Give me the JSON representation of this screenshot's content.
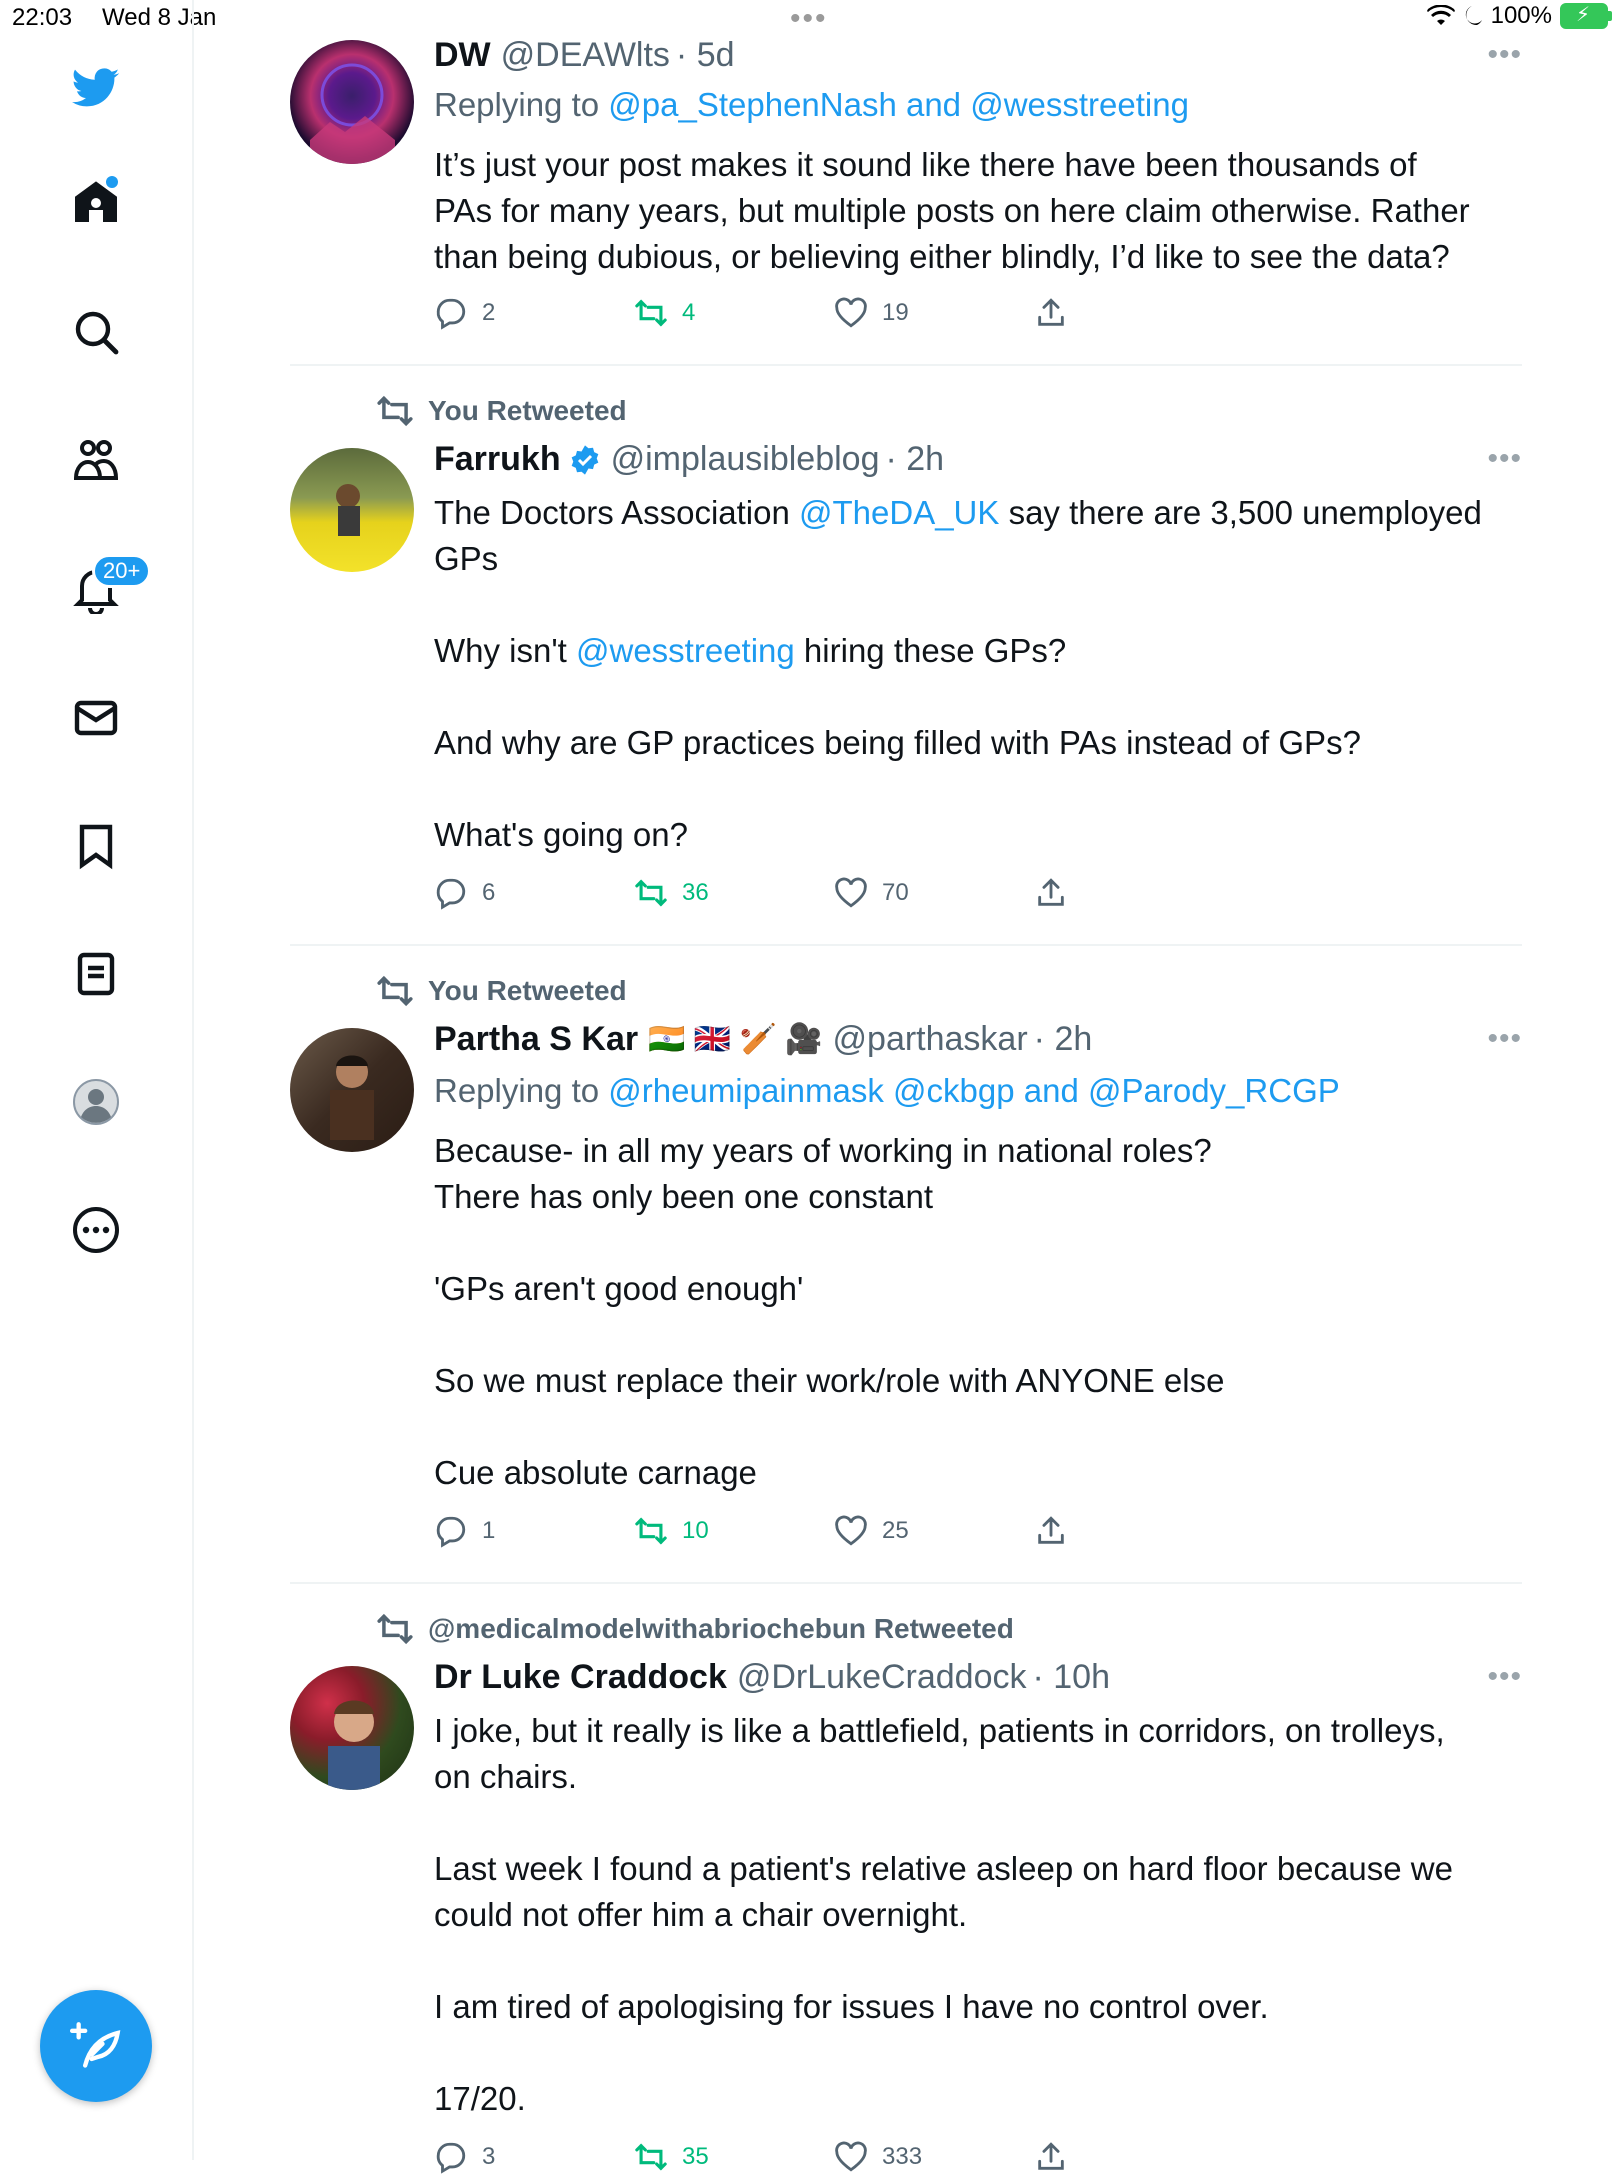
{
  "status_bar": {
    "time": "22:03",
    "date": "Wed 8 Jan",
    "battery": "100%"
  },
  "sidebar": {
    "notifications_badge": "20+"
  },
  "tweets": [
    {
      "name": "DW",
      "handle": "@DEAWlts",
      "time": "· 5d",
      "replying_label": "Replying to ",
      "replying_to": "@pa_StephenNash and @wesstreeting",
      "lines": [
        "It’s just your post makes it sound like there have been thousands of",
        "PAs for many years, but multiple posts on here claim otherwise. Rather",
        "than being dubious, or believing either blindly, I’d like to see the data?"
      ],
      "replies": "2",
      "retweets": "4",
      "likes": "19"
    },
    {
      "social": "You Retweeted",
      "name": "Farrukh",
      "handle": "@implausibleblog",
      "time": "· 2h",
      "line1_pre": "The Doctors Association ",
      "line1_link": "@TheDA_UK",
      "line1_post": " say there are 3,500 unemployed",
      "line2": "GPs",
      "line3_pre": "Why isn't ",
      "line3_link": "@wesstreeting",
      "line3_post": " hiring these GPs?",
      "line4": "And why are GP practices being filled with PAs instead of GPs?",
      "line5": "What's going on?",
      "replies": "6",
      "retweets": "36",
      "likes": "70"
    },
    {
      "social": "You Retweeted",
      "name": "Partha S Kar",
      "emojis": "🇮🇳 🇬🇧 🏏 🎥",
      "handle": "@parthaskar",
      "time": "· 2h",
      "replying_label": "Replying to ",
      "replying_to": "@rheumipainmask @ckbgp and @Parody_RCGP",
      "line1": "Because- in all my years of working in national roles?",
      "line2": "There has only been one constant",
      "line3": "'GPs aren't good enough'",
      "line4": "So we must replace their work/role with ANYONE else",
      "line5": "Cue absolute carnage",
      "replies": "1",
      "retweets": "10",
      "likes": "25"
    },
    {
      "social": "@medicalmodelwithabriochebun Retweeted",
      "name": "Dr Luke Craddock",
      "handle": "@DrLukeCraddock",
      "time": "· 10h",
      "line1": "I joke, but it really is like a battlefield, patients in corridors, on trolleys,",
      "line2": "on chairs.",
      "line3": "Last week I found a patient's relative asleep on hard floor because we",
      "line4": "could not offer him a chair overnight.",
      "line5": "I am tired of apologising for issues I have no control over.",
      "line6": "17/20.",
      "replies": "3",
      "retweets": "35",
      "likes": "333"
    }
  ],
  "icons": {
    "nav": [
      "twitter-logo",
      "home-icon",
      "search-icon",
      "communities-icon",
      "notifications-icon",
      "messages-icon",
      "bookmarks-icon",
      "lists-icon",
      "profile-icon",
      "more-icon"
    ],
    "actions": [
      "reply-icon",
      "retweet-icon",
      "like-icon",
      "share-icon"
    ]
  },
  "colors": {
    "accent": "#1d9bf0",
    "retweet": "#00ba7c",
    "secondary_text": "#536471",
    "text": "#0f1419"
  }
}
